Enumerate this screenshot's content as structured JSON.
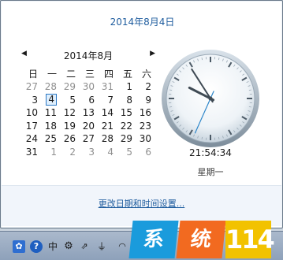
{
  "header": {
    "date": "2014年8月4日"
  },
  "calendar": {
    "month": "2014年8月",
    "weekdays": [
      "日",
      "一",
      "二",
      "三",
      "四",
      "五",
      "六"
    ],
    "weeks": [
      [
        {
          "d": "27",
          "o": true
        },
        {
          "d": "28",
          "o": true
        },
        {
          "d": "29",
          "o": true
        },
        {
          "d": "30",
          "o": true
        },
        {
          "d": "31",
          "o": true
        },
        {
          "d": "1"
        },
        {
          "d": "2"
        }
      ],
      [
        {
          "d": "3"
        },
        {
          "d": "4",
          "today": true
        },
        {
          "d": "5"
        },
        {
          "d": "6"
        },
        {
          "d": "7"
        },
        {
          "d": "8"
        },
        {
          "d": "9"
        }
      ],
      [
        {
          "d": "10"
        },
        {
          "d": "11"
        },
        {
          "d": "12"
        },
        {
          "d": "13"
        },
        {
          "d": "14"
        },
        {
          "d": "15"
        },
        {
          "d": "16"
        }
      ],
      [
        {
          "d": "17"
        },
        {
          "d": "18"
        },
        {
          "d": "19"
        },
        {
          "d": "20"
        },
        {
          "d": "21"
        },
        {
          "d": "22"
        },
        {
          "d": "23"
        }
      ],
      [
        {
          "d": "24"
        },
        {
          "d": "25"
        },
        {
          "d": "26"
        },
        {
          "d": "27"
        },
        {
          "d": "28"
        },
        {
          "d": "29"
        },
        {
          "d": "30"
        }
      ],
      [
        {
          "d": "31"
        },
        {
          "d": "1",
          "o": true
        },
        {
          "d": "2",
          "o": true
        },
        {
          "d": "3",
          "o": true
        },
        {
          "d": "4",
          "o": true
        },
        {
          "d": "5",
          "o": true
        },
        {
          "d": "6",
          "o": true
        }
      ]
    ]
  },
  "clock": {
    "time": "21:54:34",
    "weekday": "星期一",
    "hour": 21,
    "minute": 54,
    "second": 34
  },
  "footer": {
    "settings_link": "更改日期和时间设置..."
  },
  "taskbar": {
    "ime_label": "中"
  },
  "logo": {
    "part1": "系",
    "part2": "统",
    "part3": "114"
  },
  "colors": {
    "accent": "#1e5c9e",
    "today_border": "#2c78c4",
    "logo_blue": "#1a9bdc",
    "logo_orange": "#f26a20",
    "logo_yellow": "#f2c200"
  }
}
